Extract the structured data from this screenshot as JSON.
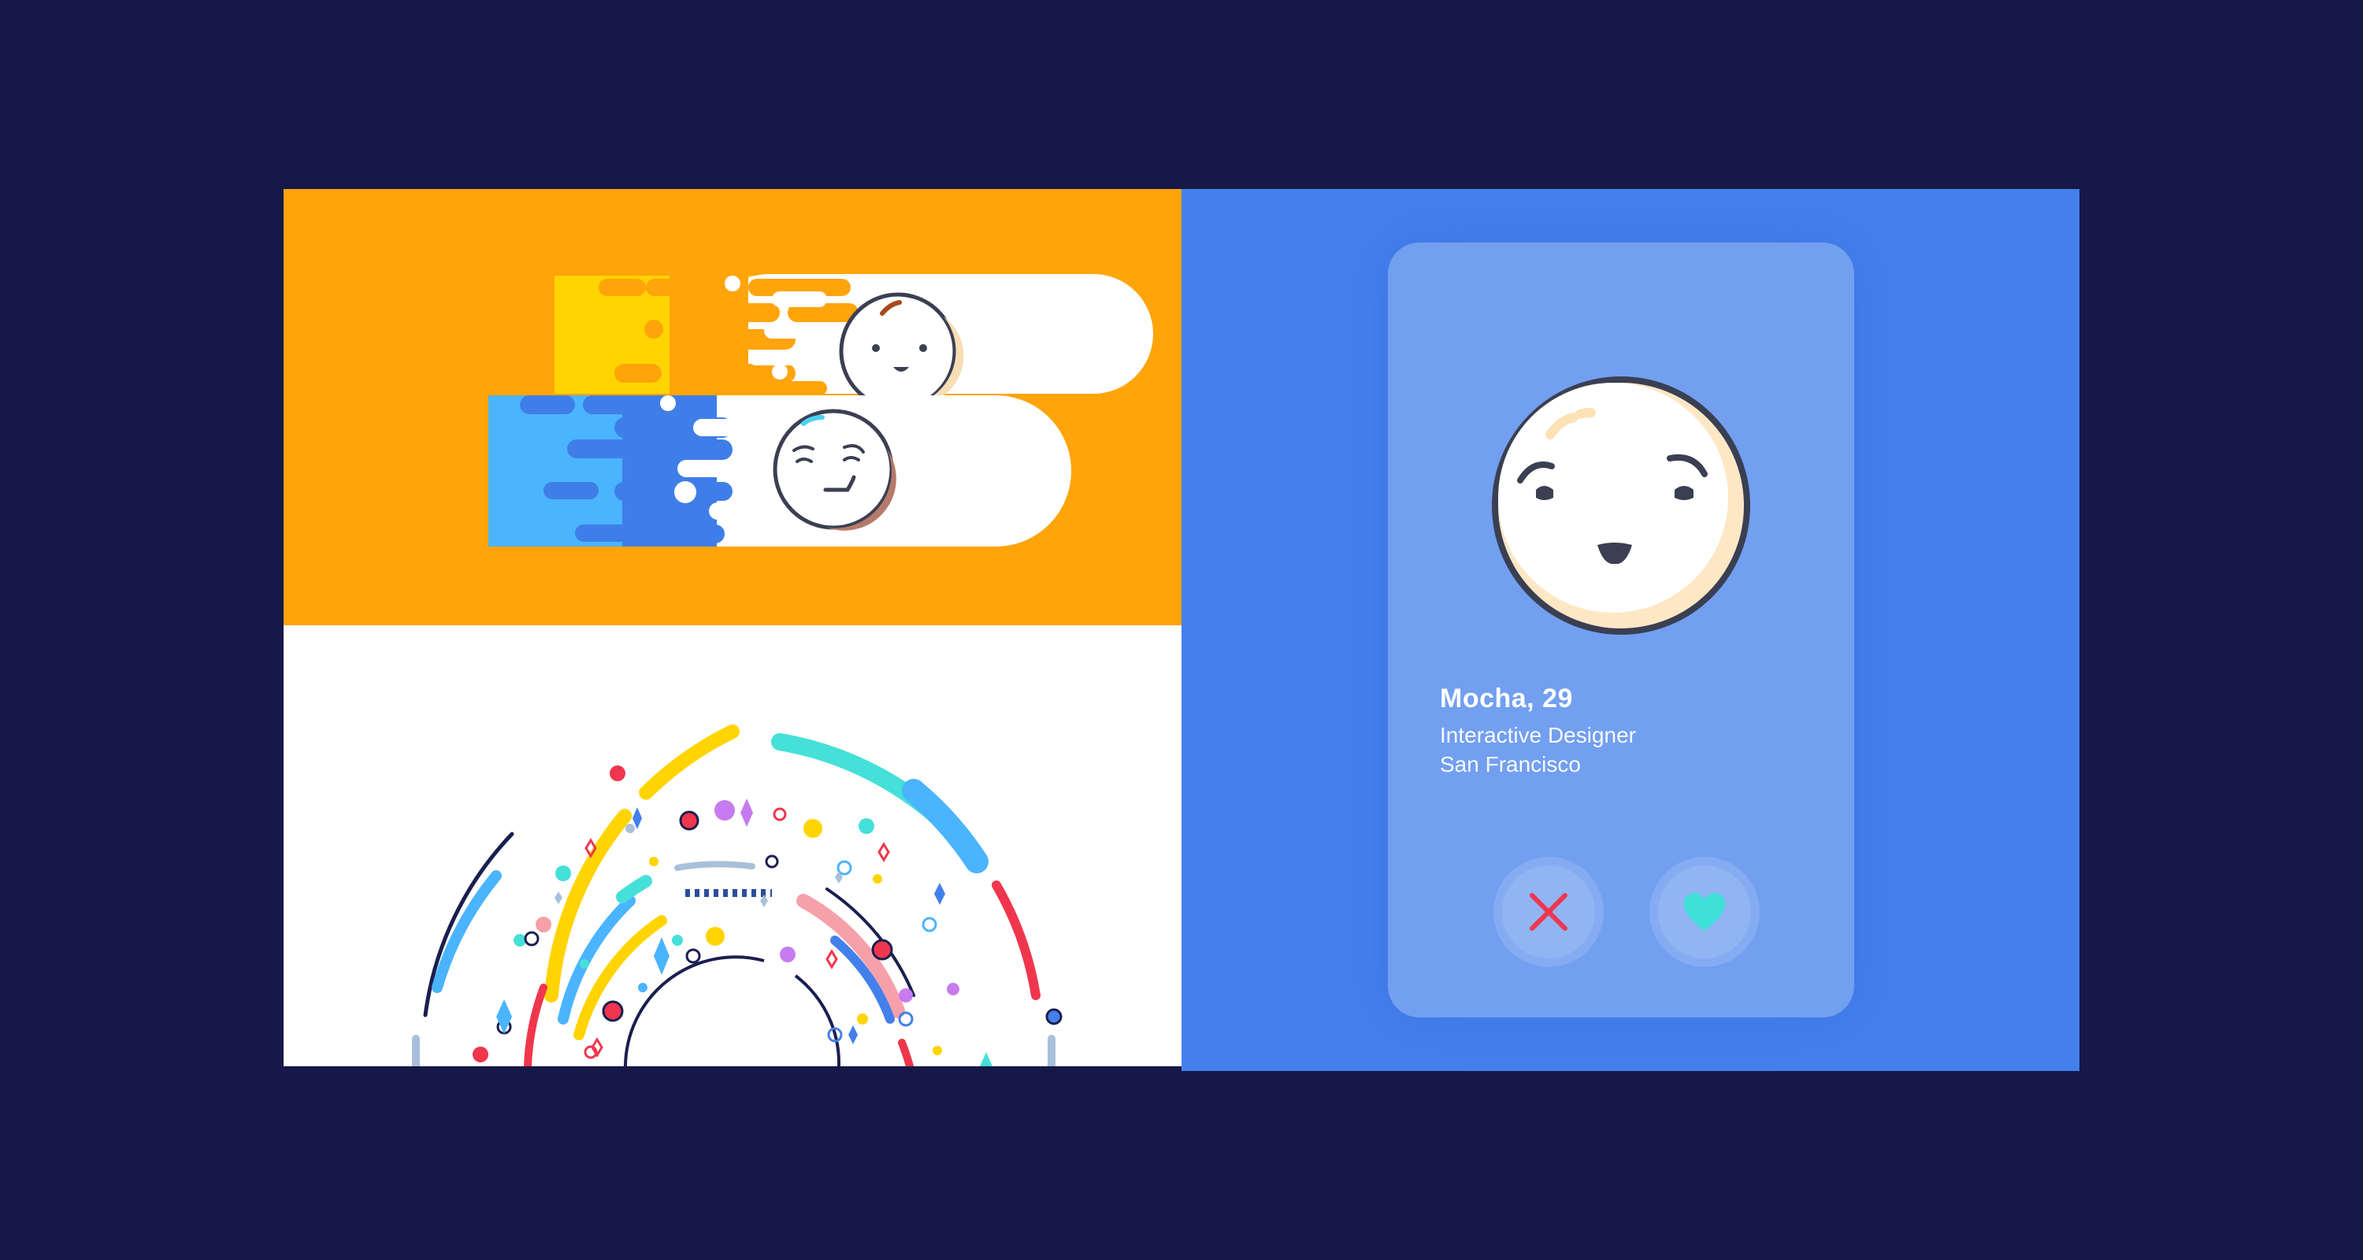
{
  "profile": {
    "name": "Mocha, 29",
    "role": "Interactive Designer",
    "location": "San Francisco"
  },
  "actions": {
    "dislike_icon": "close-icon",
    "like_icon": "heart-icon"
  },
  "colors": {
    "background": "#161847",
    "orange_panel": "#FFA40A",
    "blue_panel": "#4480EC",
    "card": "#729FF0",
    "dislike": "#F0364D",
    "like": "#3EE0D8",
    "face_outline": "#3A3F52"
  }
}
